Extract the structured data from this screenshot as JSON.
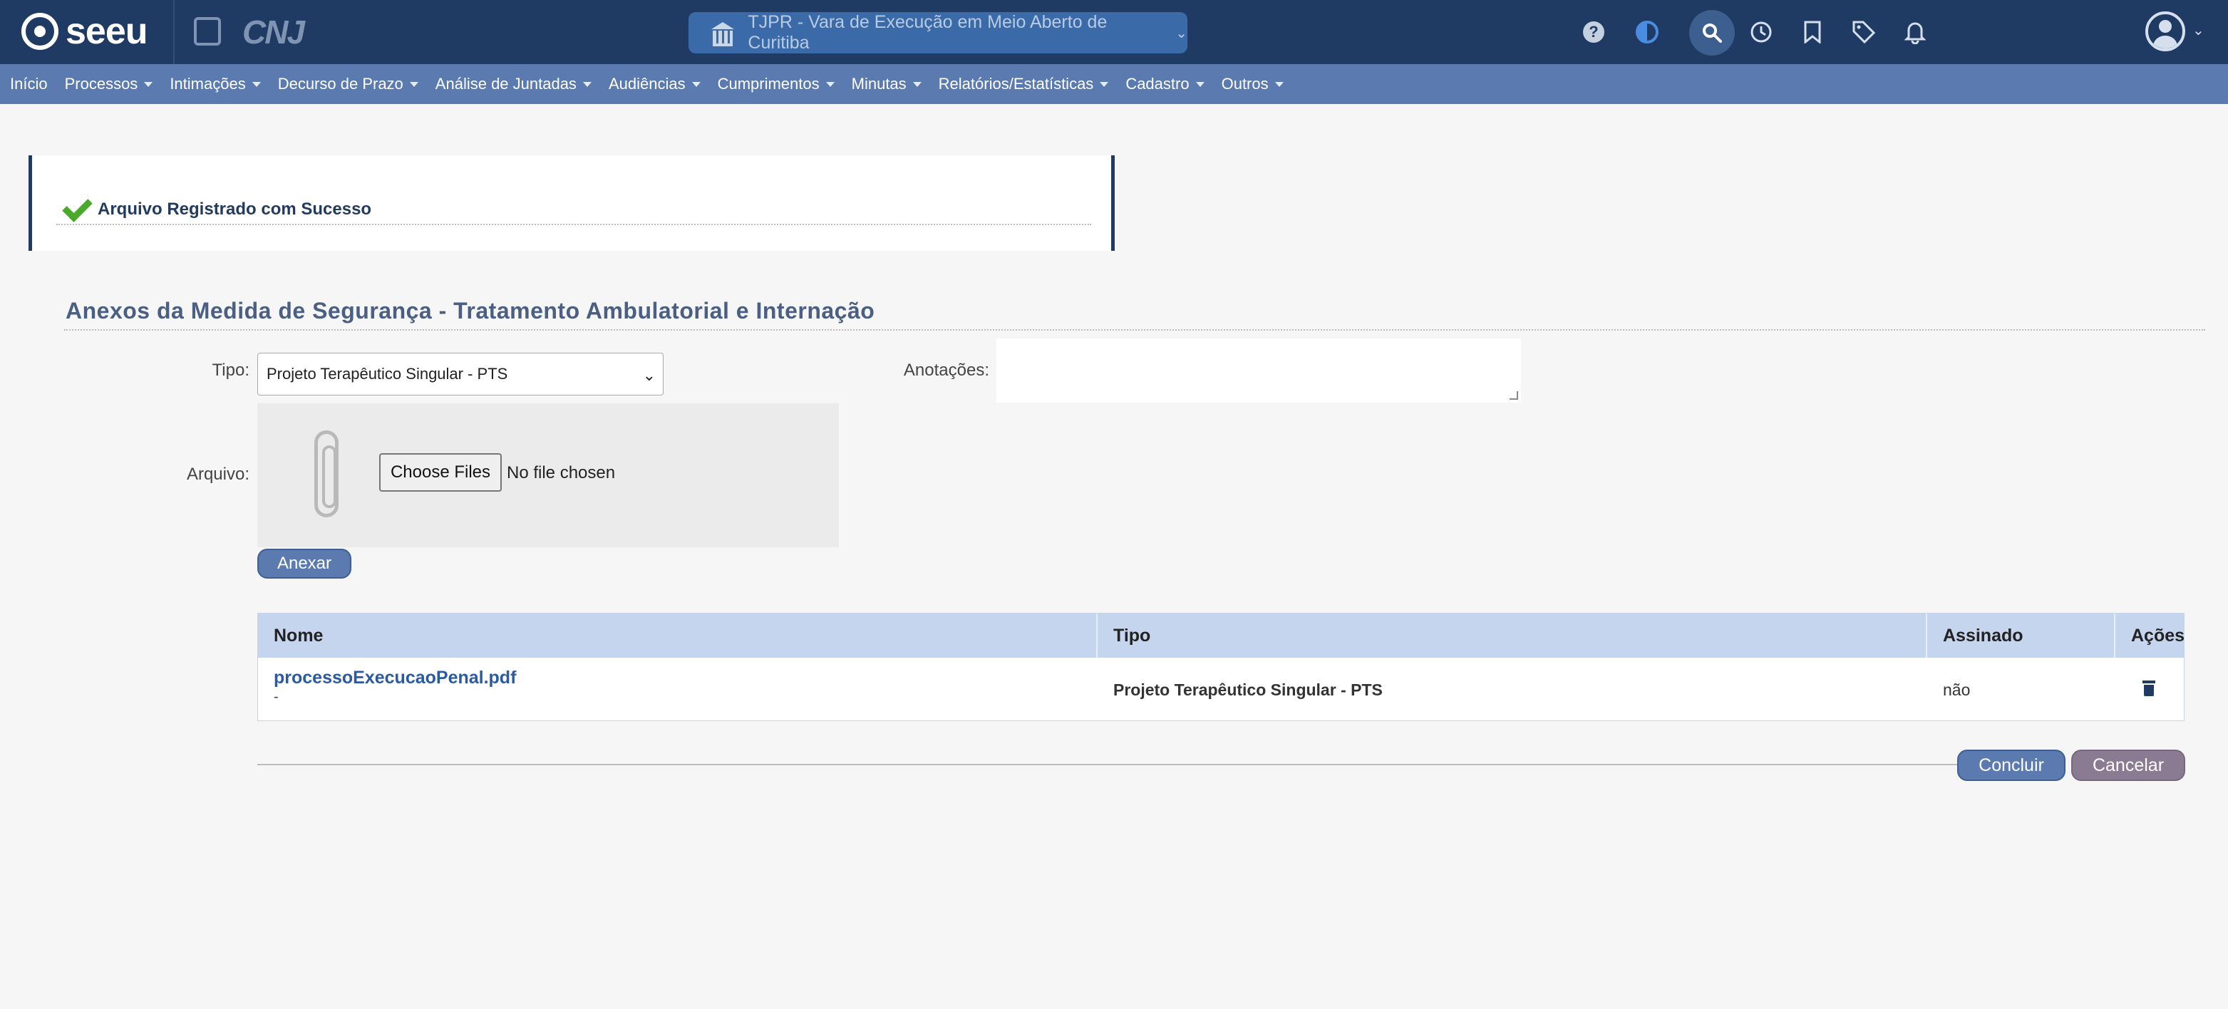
{
  "header": {
    "logo_text": "seeu",
    "cnj_text": "CNJ",
    "court_selector": "TJPR - Vara de Execução em Meio Aberto de Curitiba",
    "icons": [
      "help-icon",
      "contrast-icon",
      "search-icon",
      "history-icon",
      "bookmark-icon",
      "tag-icon",
      "bell-icon",
      "user-avatar-icon"
    ]
  },
  "menu": {
    "items": [
      {
        "label": "Início",
        "has_caret": false
      },
      {
        "label": "Processos",
        "has_caret": true
      },
      {
        "label": "Intimações",
        "has_caret": true
      },
      {
        "label": "Decurso de Prazo",
        "has_caret": true
      },
      {
        "label": "Análise de Juntadas",
        "has_caret": true
      },
      {
        "label": "Audiências",
        "has_caret": true
      },
      {
        "label": "Cumprimentos",
        "has_caret": true
      },
      {
        "label": "Minutas",
        "has_caret": true
      },
      {
        "label": "Relatórios/Estatísticas",
        "has_caret": true
      },
      {
        "label": "Cadastro",
        "has_caret": true
      },
      {
        "label": "Outros",
        "has_caret": true
      }
    ]
  },
  "alert": {
    "message": "Arquivo Registrado com Sucesso"
  },
  "section": {
    "title": "Anexos da Medida de Segurança - Tratamento Ambulatorial e Internação"
  },
  "form": {
    "tipo_label": "Tipo:",
    "tipo_value": "Projeto Terapêutico Singular - PTS",
    "anotacoes_label": "Anotações:",
    "anotacoes_value": "",
    "arquivo_label": "Arquivo:",
    "choose_files_label": "Choose Files",
    "file_status": "No file chosen",
    "anexar_label": "Anexar"
  },
  "table": {
    "headers": [
      "Nome",
      "Tipo",
      "Assinado",
      "Ações"
    ],
    "rows": [
      {
        "nome": "processoExecucaoPenal.pdf",
        "nome_sub": "-",
        "tipo": "Projeto Terapêutico Singular - PTS",
        "assinado": "não"
      }
    ]
  },
  "actions": {
    "concluir_label": "Concluir",
    "cancelar_label": "Cancelar"
  },
  "colors": {
    "topbar": "#1f3a63",
    "menubar": "#5b7bb0",
    "primary_button": "#5b7bb0",
    "cancel_button": "#8a7a92",
    "success_check": "#4aa82a",
    "table_header": "#c6d5ee"
  }
}
